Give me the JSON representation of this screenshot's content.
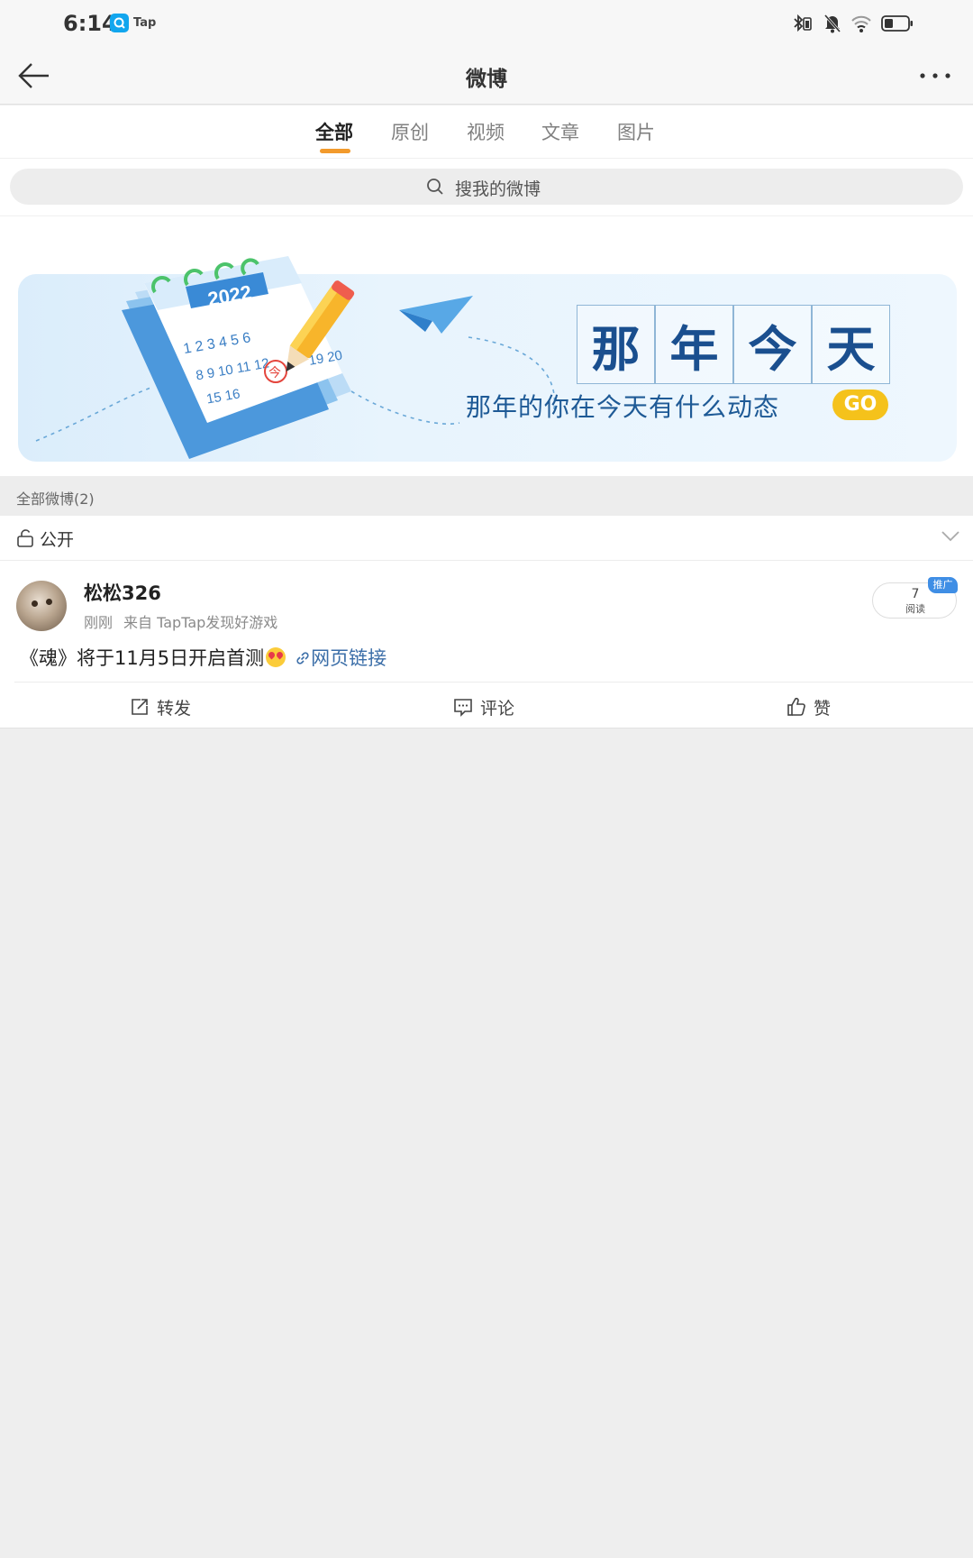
{
  "status_bar": {
    "time": "6:14",
    "app_label": "Tap",
    "icons": [
      "tap-app-icon",
      "bluetooth-icon",
      "mute-icon",
      "wifi-icon",
      "battery-icon"
    ]
  },
  "nav": {
    "title": "微博",
    "back_icon": "arrow-left-icon",
    "more_icon": "more-dots-icon"
  },
  "tabs": [
    {
      "label": "全部",
      "active": true
    },
    {
      "label": "原创",
      "active": false
    },
    {
      "label": "视频",
      "active": false
    },
    {
      "label": "文章",
      "active": false
    },
    {
      "label": "图片",
      "active": false
    }
  ],
  "search": {
    "placeholder": "搜我的微博"
  },
  "banner": {
    "year": "2022",
    "title_chars": [
      "那",
      "年",
      "今",
      "天"
    ],
    "subtitle": "那年的你在今天有什么动态",
    "go_label": "GO",
    "calendar_numbers": [
      "1 2 3 4 5 6",
      "8 9 10 11 12",
      "15 16",
      "19 20"
    ],
    "today_mark": "今"
  },
  "section": {
    "label": "全部微博(2)"
  },
  "privacy": {
    "label": "公开"
  },
  "post": {
    "username": "松松326",
    "time": "刚刚",
    "source": "来自 TapTap发现好游戏",
    "text": "《魂》将于11月5日开启首测",
    "link_text": "网页链接",
    "read_count": "7",
    "read_label": "阅读",
    "promo_badge": "推广",
    "actions": {
      "repost": "转发",
      "comment": "评论",
      "like": "赞"
    }
  },
  "colors": {
    "accent_underline": "#f29a2c",
    "link": "#3b6ea8",
    "banner_title": "#1a4f8f",
    "go_button": "#f5c21b",
    "promo_badge": "#3f8ee5"
  }
}
